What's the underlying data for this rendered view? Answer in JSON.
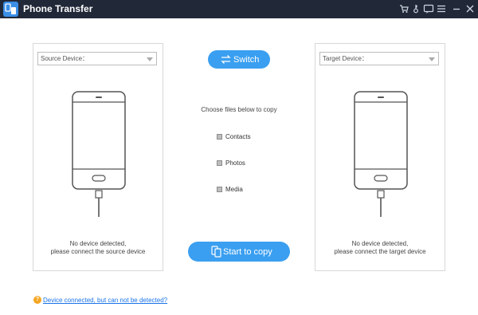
{
  "app": {
    "title": "Phone Transfer"
  },
  "titlebar_icons": [
    "cart-icon",
    "key-icon",
    "chat-icon",
    "menu-icon",
    "minimize-icon",
    "close-icon"
  ],
  "source": {
    "select_label": "Source Device：",
    "message_line1": "No device detected,",
    "message_line2": "please connect the source device"
  },
  "target": {
    "select_label": "Target Device：",
    "message_line1": "No device detected,",
    "message_line2": "please connect the target device"
  },
  "center": {
    "switch_label": "Switch",
    "choose_label": "Choose files below to copy",
    "options": [
      {
        "label": "Contacts",
        "checked": false
      },
      {
        "label": "Photos",
        "checked": false
      },
      {
        "label": "Media",
        "checked": false
      }
    ],
    "start_label": "Start to copy"
  },
  "help": {
    "icon": "question-icon",
    "link_text": "Device connected, but can not be detected?"
  },
  "colors": {
    "titlebar": "#212838",
    "accent": "#3a9ff0",
    "link": "#1a73e8",
    "help_icon": "#f5a623"
  }
}
